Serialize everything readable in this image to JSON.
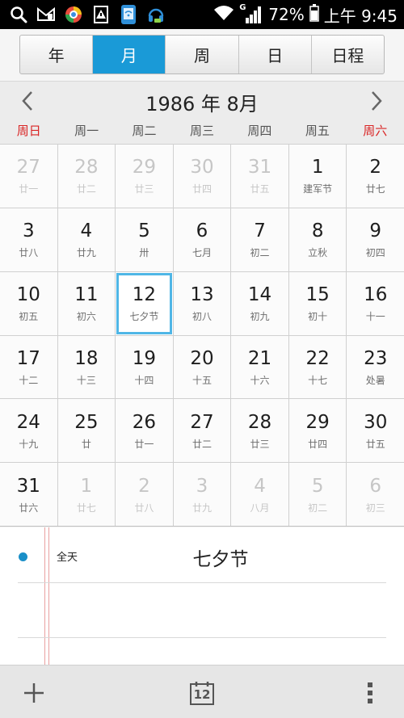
{
  "status_bar": {
    "battery": "72%",
    "time": "上午 9:45",
    "net_label": "G",
    "icons": [
      "search-icon",
      "mail-shield-icon",
      "browser-icon",
      "warning-doc-icon",
      "wifi-phone-icon",
      "headset-icon",
      "wifi-icon",
      "signal-icon",
      "battery-icon"
    ]
  },
  "view_tabs": [
    {
      "label": "年",
      "active": false
    },
    {
      "label": "月",
      "active": true
    },
    {
      "label": "周",
      "active": false
    },
    {
      "label": "日",
      "active": false
    },
    {
      "label": "日程",
      "active": false
    }
  ],
  "month_header": {
    "title": "1986 年 8月"
  },
  "weekdays": [
    "周日",
    "周一",
    "周二",
    "周三",
    "周四",
    "周五",
    "周六"
  ],
  "calendar": {
    "selected_day": "12",
    "days": [
      {
        "day": "27",
        "lunar": "廿一",
        "other": true
      },
      {
        "day": "28",
        "lunar": "廿二",
        "other": true
      },
      {
        "day": "29",
        "lunar": "廿三",
        "other": true
      },
      {
        "day": "30",
        "lunar": "廿四",
        "other": true
      },
      {
        "day": "31",
        "lunar": "廿五",
        "other": true
      },
      {
        "day": "1",
        "lunar": "建军节",
        "other": false
      },
      {
        "day": "2",
        "lunar": "廿七",
        "other": false
      },
      {
        "day": "3",
        "lunar": "廿八",
        "other": false
      },
      {
        "day": "4",
        "lunar": "廿九",
        "other": false
      },
      {
        "day": "5",
        "lunar": "卅",
        "other": false
      },
      {
        "day": "6",
        "lunar": "七月",
        "other": false
      },
      {
        "day": "7",
        "lunar": "初二",
        "other": false
      },
      {
        "day": "8",
        "lunar": "立秋",
        "other": false
      },
      {
        "day": "9",
        "lunar": "初四",
        "other": false
      },
      {
        "day": "10",
        "lunar": "初五",
        "other": false
      },
      {
        "day": "11",
        "lunar": "初六",
        "other": false
      },
      {
        "day": "12",
        "lunar": "七夕节",
        "other": false
      },
      {
        "day": "13",
        "lunar": "初八",
        "other": false
      },
      {
        "day": "14",
        "lunar": "初九",
        "other": false
      },
      {
        "day": "15",
        "lunar": "初十",
        "other": false
      },
      {
        "day": "16",
        "lunar": "十一",
        "other": false
      },
      {
        "day": "17",
        "lunar": "十二",
        "other": false
      },
      {
        "day": "18",
        "lunar": "十三",
        "other": false
      },
      {
        "day": "19",
        "lunar": "十四",
        "other": false
      },
      {
        "day": "20",
        "lunar": "十五",
        "other": false
      },
      {
        "day": "21",
        "lunar": "十六",
        "other": false
      },
      {
        "day": "22",
        "lunar": "十七",
        "other": false
      },
      {
        "day": "23",
        "lunar": "处暑",
        "other": false
      },
      {
        "day": "24",
        "lunar": "十九",
        "other": false
      },
      {
        "day": "25",
        "lunar": "廿",
        "other": false
      },
      {
        "day": "26",
        "lunar": "廿一",
        "other": false
      },
      {
        "day": "27",
        "lunar": "廿二",
        "other": false
      },
      {
        "day": "28",
        "lunar": "廿三",
        "other": false
      },
      {
        "day": "29",
        "lunar": "廿四",
        "other": false
      },
      {
        "day": "30",
        "lunar": "廿五",
        "other": false
      },
      {
        "day": "31",
        "lunar": "廿六",
        "other": false
      },
      {
        "day": "1",
        "lunar": "廿七",
        "other": true
      },
      {
        "day": "2",
        "lunar": "廿八",
        "other": true
      },
      {
        "day": "3",
        "lunar": "廿九",
        "other": true
      },
      {
        "day": "4",
        "lunar": "八月",
        "other": true
      },
      {
        "day": "5",
        "lunar": "初二",
        "other": true
      },
      {
        "day": "6",
        "lunar": "初三",
        "other": true
      }
    ]
  },
  "events": {
    "items": [
      {
        "time_label": "全天",
        "title": "七夕节"
      }
    ]
  },
  "bottom_bar": {
    "today_number": "12"
  },
  "colors": {
    "accent": "#1a9ad7",
    "weekend_red": "#d92424",
    "selected_outline": "#4fb6e6",
    "event_dot": "#1a8fc8"
  }
}
